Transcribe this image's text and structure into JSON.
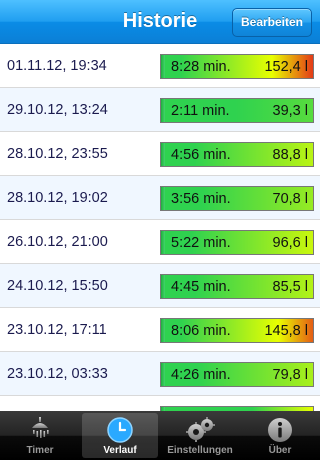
{
  "header": {
    "title": "Historie",
    "edit_label": "Bearbeiten"
  },
  "colors": {
    "low": "#2fd24f",
    "mid": "#e8ff00",
    "high": "#e3161c"
  },
  "history": [
    {
      "date": "01.11.12, 19:34",
      "duration": "8:28 min.",
      "volume": "152,4 l"
    },
    {
      "date": "29.10.12, 13:24",
      "duration": "2:11 min.",
      "volume": "39,3 l"
    },
    {
      "date": "28.10.12, 23:55",
      "duration": "4:56 min.",
      "volume": "88,8 l"
    },
    {
      "date": "28.10.12, 19:02",
      "duration": "3:56 min.",
      "volume": "70,8 l"
    },
    {
      "date": "26.10.12, 21:00",
      "duration": "5:22 min.",
      "volume": "96,6 l"
    },
    {
      "date": "24.10.12, 15:50",
      "duration": "4:45 min.",
      "volume": "85,5 l"
    },
    {
      "date": "23.10.12, 17:11",
      "duration": "8:06 min.",
      "volume": "145,8 l"
    },
    {
      "date": "23.10.12, 03:33",
      "duration": "4:26 min.",
      "volume": "79,8 l"
    },
    {
      "date": "",
      "duration": "",
      "volume": ""
    }
  ],
  "tabs": [
    {
      "label": "Timer",
      "icon": "shower-icon",
      "active": false
    },
    {
      "label": "Verlauf",
      "icon": "clock-icon",
      "active": true
    },
    {
      "label": "Einstellungen",
      "icon": "gears-icon",
      "active": false
    },
    {
      "label": "Über",
      "icon": "info-icon",
      "active": false
    }
  ]
}
